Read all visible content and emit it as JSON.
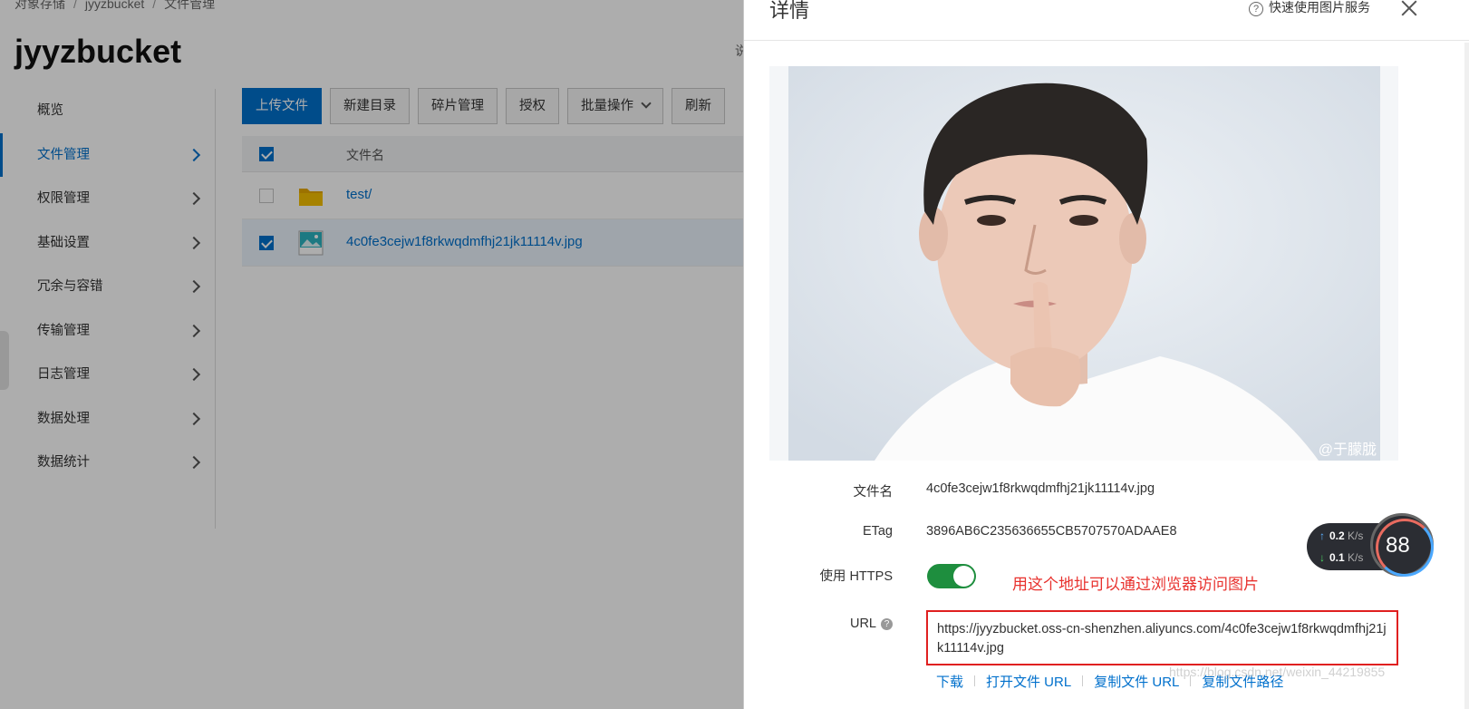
{
  "breadcrumb": [
    "对象存储",
    "jyyzbucket",
    "文件管理"
  ],
  "bucket_title": "jyyzbucket",
  "cut_text": "说",
  "nav": [
    {
      "label": "概览"
    },
    {
      "label": "文件管理",
      "active": true
    },
    {
      "label": "权限管理"
    },
    {
      "label": "基础设置"
    },
    {
      "label": "冗余与容错"
    },
    {
      "label": "传输管理"
    },
    {
      "label": "日志管理"
    },
    {
      "label": "数据处理"
    },
    {
      "label": "数据统计"
    }
  ],
  "toolbar": {
    "upload": "上传文件",
    "new_dir": "新建目录",
    "fragments": "碎片管理",
    "authorize": "授权",
    "batch": "批量操作",
    "refresh": "刷新"
  },
  "table": {
    "header": "文件名",
    "rows": [
      {
        "name": "test/",
        "type": "folder",
        "checked": false
      },
      {
        "name": "4c0fe3cejw1f8rkwqdmfhj21jk11114v.jpg",
        "type": "image",
        "checked": true
      }
    ]
  },
  "drawer": {
    "title": "详情",
    "help": "快速使用图片服务",
    "watermark": "@于朦胧",
    "props": {
      "filename_label": "文件名",
      "filename_value": "4c0fe3cejw1f8rkwqdmfhj21jk11114v.jpg",
      "etag_label": "ETag",
      "etag_value": "3896AB6C235636655CB5707570ADAAE8",
      "https_label": "使用 HTTPS",
      "https_on": true,
      "url_label": "URL",
      "url_value": "https://jyyzbucket.oss-cn-shenzhen.aliyuncs.com/4c0fe3cejw1f8rkwqdmfhj21jk11114v.jpg"
    },
    "annotation": "用这个地址可以通过浏览器访问图片",
    "actions": [
      "下载",
      "打开文件 URL",
      "复制文件 URL",
      "复制文件路径"
    ]
  },
  "speed": {
    "up": "0.2",
    "down": "0.1",
    "unit": "K/s",
    "percent": "88"
  },
  "blog_watermark": "https://blog.csdn.net/weixin_44219855",
  "colors": {
    "accent": "#0070cc",
    "toggle_on": "#1e8e3e",
    "annotation": "#e8312d"
  }
}
